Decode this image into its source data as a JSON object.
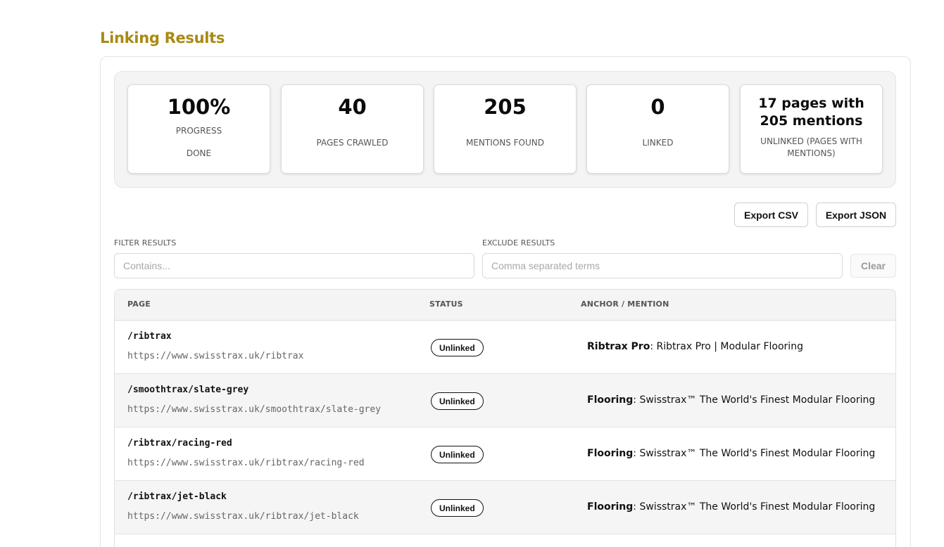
{
  "page": {
    "title": "Linking Results"
  },
  "stats": [
    {
      "value": "100%",
      "label": "PROGRESS",
      "sub": "DONE"
    },
    {
      "value": "40",
      "label": "PAGES CRAWLED"
    },
    {
      "value": "205",
      "label": "MENTIONS FOUND"
    },
    {
      "value": "0",
      "label": "LINKED"
    },
    {
      "value": "17 pages with 205 mentions",
      "label": "UNLINKED (PAGES WITH MENTIONS)"
    }
  ],
  "toolbar": {
    "export_csv": "Export CSV",
    "export_json": "Export JSON"
  },
  "filters": {
    "filter_label": "FILTER RESULTS",
    "filter_placeholder": "Contains...",
    "exclude_label": "EXCLUDE RESULTS",
    "exclude_placeholder": "Comma separated terms",
    "clear_label": "Clear"
  },
  "table": {
    "headers": {
      "page": "PAGE",
      "status": "STATUS",
      "anchor": "ANCHOR / MENTION"
    },
    "rows": [
      {
        "path": "/ribtrax",
        "url": "https://www.swisstrax.uk/ribtrax",
        "status": "Unlinked",
        "anchor": "Ribtrax Pro",
        "mention": ": Ribtrax Pro | Modular Flooring"
      },
      {
        "path": "/smoothtrax/slate-grey",
        "url": "https://www.swisstrax.uk/smoothtrax/slate-grey",
        "status": "Unlinked",
        "anchor": "Flooring",
        "mention": ": Swisstrax™ The World's Finest Modular Flooring"
      },
      {
        "path": "/ribtrax/racing-red",
        "url": "https://www.swisstrax.uk/ribtrax/racing-red",
        "status": "Unlinked",
        "anchor": "Flooring",
        "mention": ": Swisstrax™ The World's Finest Modular Flooring"
      },
      {
        "path": "/ribtrax/jet-black",
        "url": "https://www.swisstrax.uk/ribtrax/jet-black",
        "status": "Unlinked",
        "anchor": "Flooring",
        "mention": ": Swisstrax™ The World's Finest Modular Flooring"
      }
    ]
  },
  "colors": {
    "title": "#a88a12",
    "alt_row": "#f5f5f5",
    "panel": "#f4f4f4"
  }
}
